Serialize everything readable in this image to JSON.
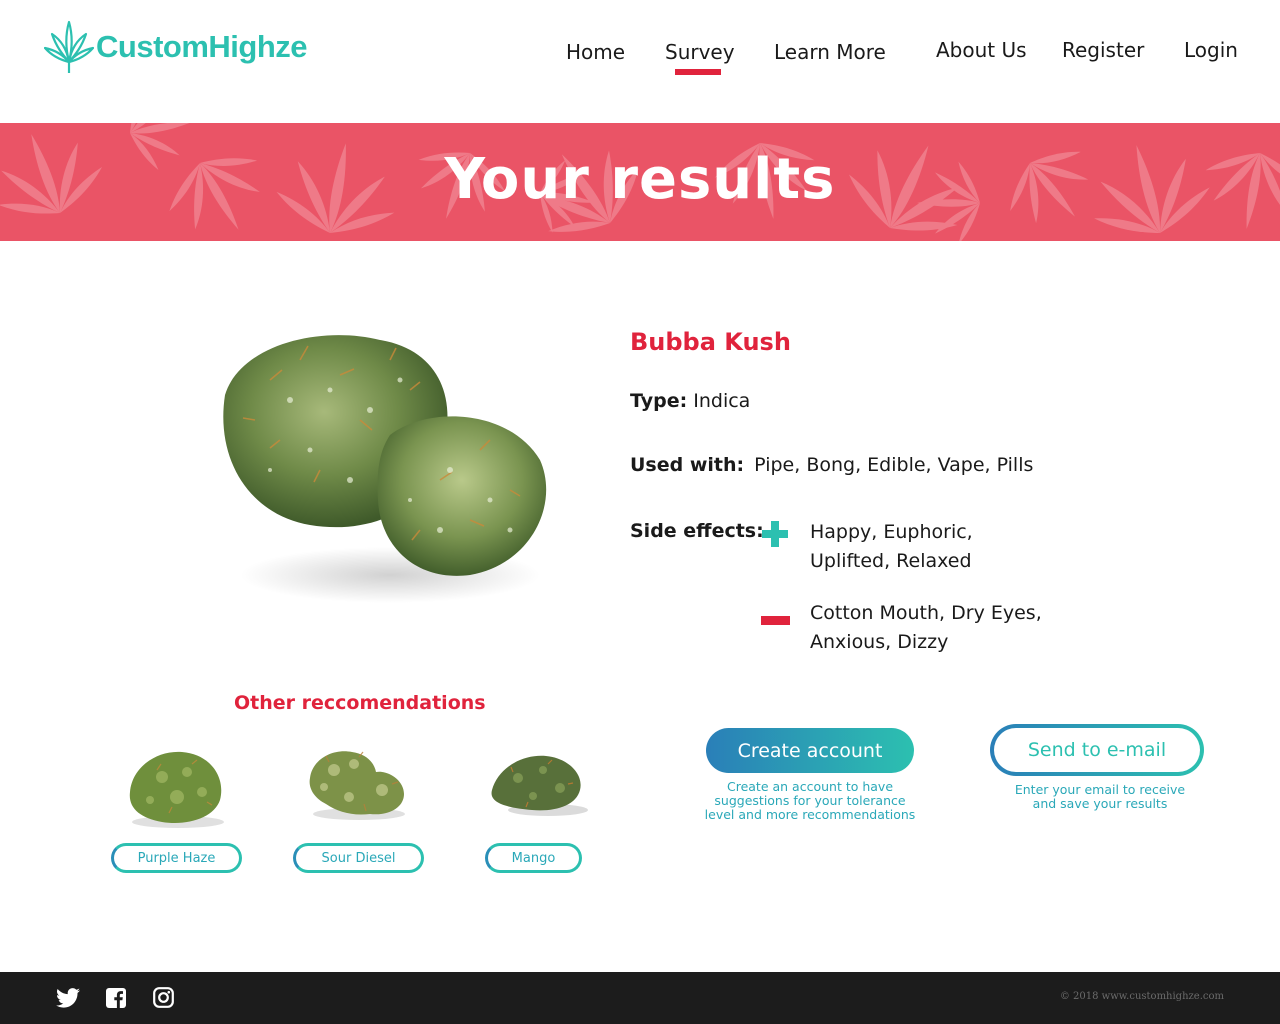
{
  "brand": {
    "name": "CustomHighze"
  },
  "nav": {
    "items": [
      "Home",
      "Survey",
      "Learn More",
      "About Us",
      "Register",
      "Login"
    ],
    "active": "Survey"
  },
  "hero": {
    "title": "Your results"
  },
  "result": {
    "name": "Bubba Kush",
    "type_label": "Type:",
    "type_value": "Indica",
    "used_label": "Used with:",
    "used_value": "Pipe, Bong, Edible, Vape, Pills",
    "effects_label": "Side effects:",
    "positive_line1": "Happy, Euphoric,",
    "positive_line2": "Uplifted, Relaxed",
    "negative_line1": "Cotton Mouth, Dry Eyes,",
    "negative_line2": "Anxious, Dizzy"
  },
  "other": {
    "title": "Other reccomendations",
    "items": [
      "Purple Haze",
      "Sour Diesel",
      "Mango"
    ]
  },
  "cta": {
    "create_label": "Create account",
    "create_note_1": "Create an account to have",
    "create_note_2": "suggestions for your tolerance",
    "create_note_3": "level and more recommendations",
    "send_label": "Send to e-mail",
    "send_note_1": "Enter your email to receive",
    "send_note_2": "and save your results"
  },
  "footer": {
    "copyright": "© 2018 www.customhighze.com"
  },
  "colors": {
    "accent_red": "#e0233c",
    "teal": "#2cc0b0",
    "blue": "#2a7fb8",
    "hero_bg": "#ea5466",
    "footer_bg": "#1c1c1c"
  }
}
